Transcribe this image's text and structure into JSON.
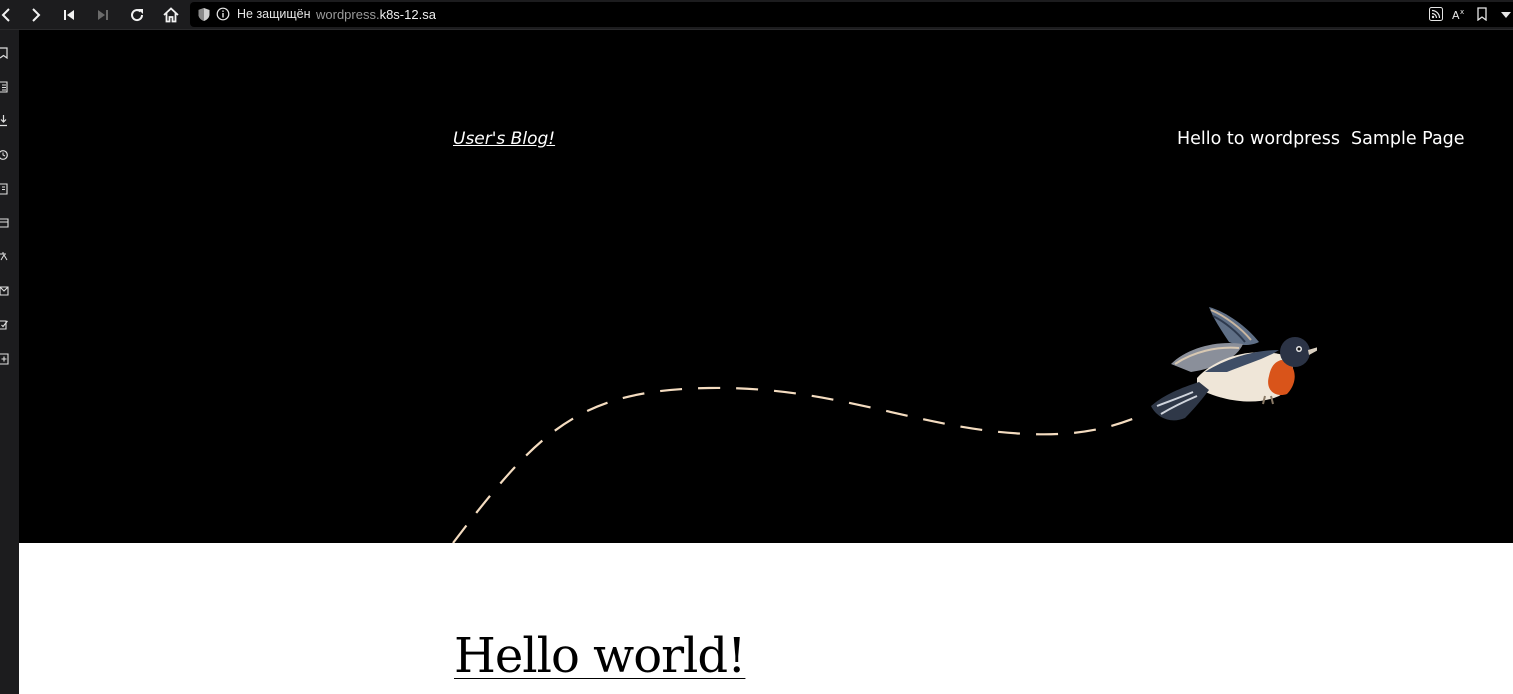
{
  "browser": {
    "security_label": "Не защищён",
    "url_prefix": "wordpress.",
    "url_host": "k8s-12.sa",
    "icons": [
      "back-icon",
      "forward-icon",
      "rewind-icon",
      "fast-forward-icon",
      "reload-icon",
      "home-icon",
      "shield-icon",
      "info-icon",
      "rss-icon",
      "translate-icon",
      "bookmark-icon",
      "menu-dropdown-icon"
    ]
  },
  "sidepanel": {
    "icons": [
      "bookmarks-icon",
      "reading-list-icon",
      "downloads-icon",
      "history-icon",
      "notes-icon",
      "window-icon",
      "translate-icon",
      "mail-icon",
      "tasks-icon",
      "add-panel-icon"
    ]
  },
  "site": {
    "title": "User's Blog!",
    "nav": [
      "Hello to wordpress",
      "Sample Page"
    ]
  },
  "post": {
    "title": "Hello world!"
  },
  "colors": {
    "hero_bg": "#000000",
    "dash": "#f4dcc0",
    "bird_throat": "#d9541a"
  }
}
